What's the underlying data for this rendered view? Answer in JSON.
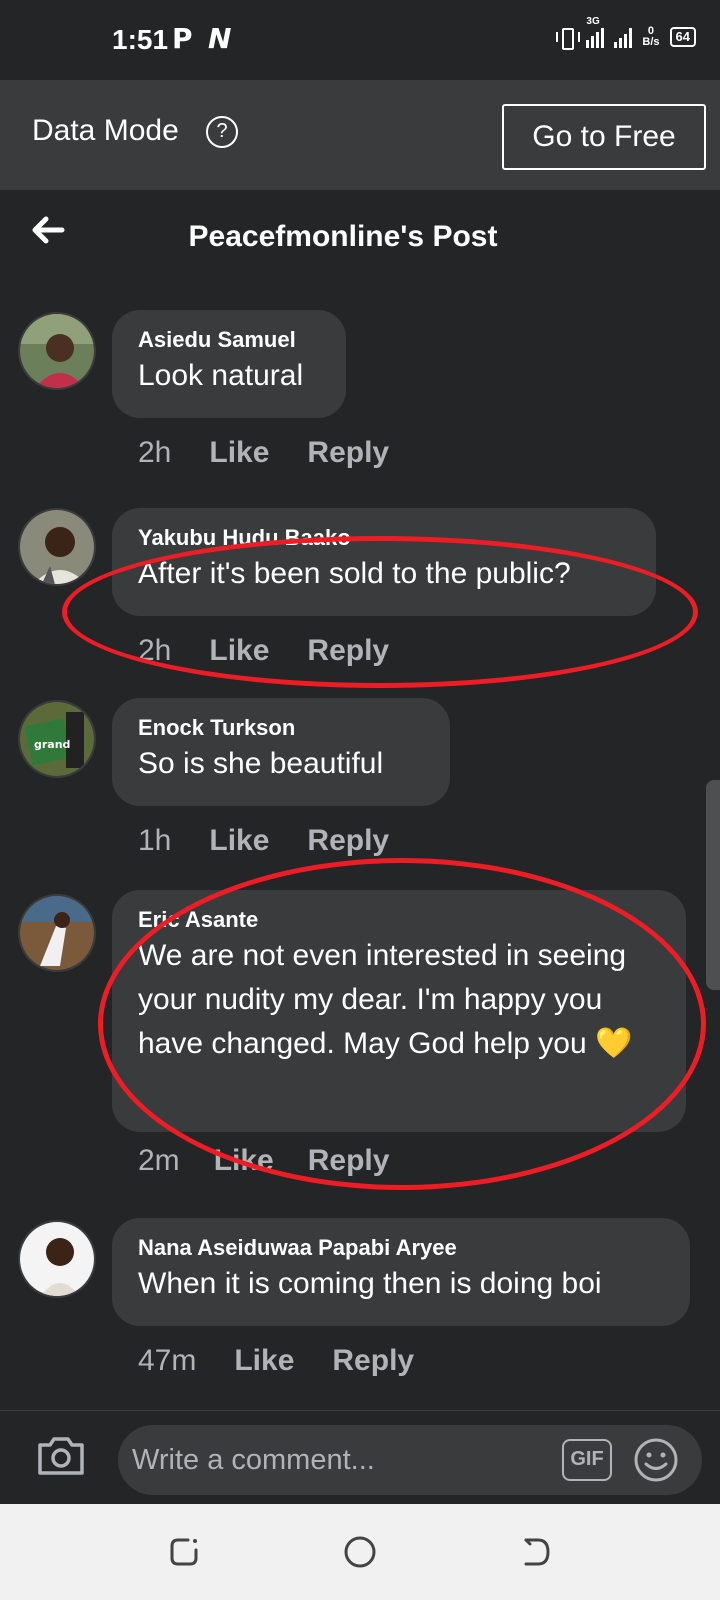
{
  "status_bar": {
    "time": "1:51",
    "app_icons": [
      "P",
      "N"
    ],
    "network": "3G",
    "speed_value": "0",
    "speed_unit": "B/s",
    "battery": "64"
  },
  "banner": {
    "label": "Data Mode",
    "help_glyph": "?",
    "button_label": "Go to Free"
  },
  "header": {
    "title": "Peacefmonline's Post"
  },
  "comments": [
    {
      "name": "Asiedu Samuel",
      "text": "Look natural",
      "time": "2h",
      "like": "Like",
      "reply": "Reply"
    },
    {
      "name": "Yakubu Hudu Baako",
      "text": "After it's been sold to the public?",
      "time": "2h",
      "like": "Like",
      "reply": "Reply"
    },
    {
      "name": "Enock Turkson",
      "text": "So is she beautiful",
      "time": "1h",
      "like": "Like",
      "reply": "Reply"
    },
    {
      "name": "Eric Asante",
      "text": "We are not even interested in seeing your nudity my dear. I'm happy you have changed. May God help you 💛",
      "time": "2m",
      "like": "Like",
      "reply": "Reply"
    },
    {
      "name": "Nana Aseiduwaa Papabi Aryee",
      "text": "When it is coming then is doing boi",
      "time": "47m",
      "like": "Like",
      "reply": "Reply"
    }
  ],
  "composer": {
    "placeholder": "Write a comment...",
    "gif_label": "GIF"
  },
  "colors": {
    "background": "#242526",
    "bubble": "#3a3b3c",
    "annotation": "#ee1d25"
  }
}
